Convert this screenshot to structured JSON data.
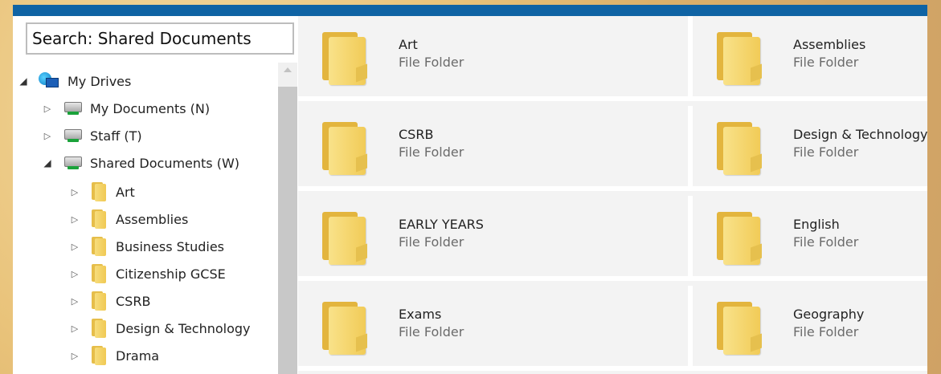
{
  "search": {
    "text": "Search: Shared Documents"
  },
  "tree": {
    "root": {
      "label": "My Drives",
      "icon": "globe-network-icon",
      "expanded": true
    },
    "drives": [
      {
        "label": "My Documents (N)",
        "icon": "network-drive-icon",
        "expanded": false
      },
      {
        "label": "Staff (T)",
        "icon": "network-drive-icon",
        "expanded": false
      },
      {
        "label": "Shared Documents (W)",
        "icon": "network-drive-icon",
        "expanded": true
      }
    ],
    "folders": [
      {
        "label": "Art"
      },
      {
        "label": "Assemblies"
      },
      {
        "label": "Business Studies"
      },
      {
        "label": "Citizenship GCSE"
      },
      {
        "label": "CSRB"
      },
      {
        "label": "Design & Technology"
      },
      {
        "label": "Drama"
      }
    ]
  },
  "grid": {
    "tiles": [
      {
        "name": "Art",
        "type": "File Folder"
      },
      {
        "name": "Assemblies",
        "type": "File Folder"
      },
      {
        "name": "CSRB",
        "type": "File Folder"
      },
      {
        "name": "Design & Technology",
        "type": "File Folder"
      },
      {
        "name": "EARLY YEARS",
        "type": "File Folder"
      },
      {
        "name": "English",
        "type": "File Folder"
      },
      {
        "name": "Exams",
        "type": "File Folder"
      },
      {
        "name": "Geography",
        "type": "File Folder"
      }
    ]
  },
  "colors": {
    "title_bar": "#0f63a4",
    "folder": "#f1cb57"
  }
}
